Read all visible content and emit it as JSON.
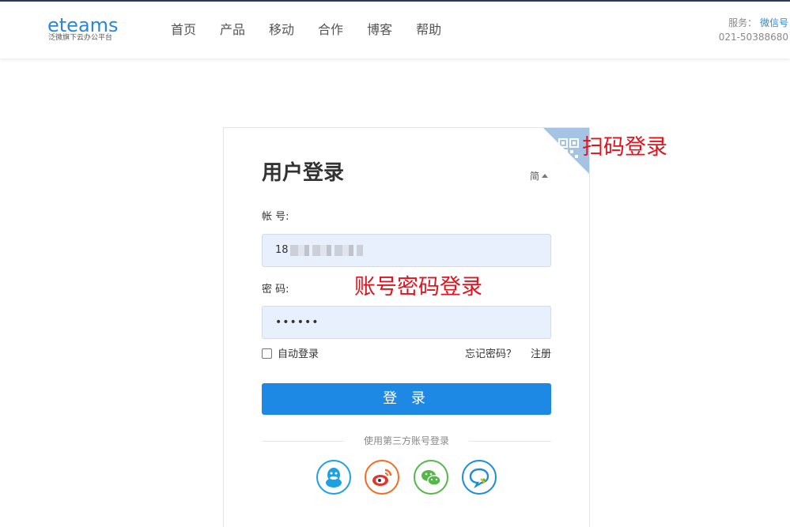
{
  "header": {
    "logo_word": "eteams",
    "logo_sub": "泛微旗下云办公平台",
    "nav": [
      "首页",
      "产品",
      "移动",
      "合作",
      "博客",
      "帮助"
    ],
    "service_label": "服务：",
    "service_link": "微信号",
    "service_phone": "021-50388680"
  },
  "login": {
    "title": "用户登录",
    "lang": "简",
    "account_label": "帐 号:",
    "account_value_visible": "18",
    "password_label": "密 码:",
    "password_value": "••••••",
    "auto_login": "自动登录",
    "forgot": "忘记密码？",
    "register": "注册",
    "submit": "登 录",
    "third_party": "使用第三方账号登录",
    "social_icons": [
      "qq-icon",
      "weibo-icon",
      "wechat-icon",
      "chat-icon"
    ]
  },
  "annotations": {
    "qr_login": "扫码登录",
    "account_password_login": "账号密码登录"
  },
  "colors": {
    "brand_blue": "#1e88e5",
    "qq": "#1da1e2",
    "weibo": "#f26d21",
    "wechat": "#54b748",
    "chat": "#1d8cd8",
    "annotation_red": "#e0141e",
    "qr_corner": "#a5c4e4"
  }
}
